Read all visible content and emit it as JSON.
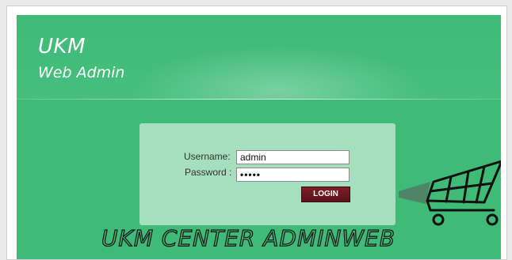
{
  "header": {
    "title": "UKM",
    "subtitle": "Web Admin"
  },
  "login": {
    "username_label": "Username:",
    "username_value": "admin",
    "password_label": "Password :",
    "password_value": "•••••",
    "button_label": "LOGIN"
  },
  "banner": {
    "text": "UKM CENTER ADMINWEB"
  },
  "decor": {
    "cart_icon": "shopping-cart-icon"
  },
  "colors": {
    "panel": "#3fba77",
    "login_box": "#a6dfbd",
    "button": "#6b1a21"
  }
}
